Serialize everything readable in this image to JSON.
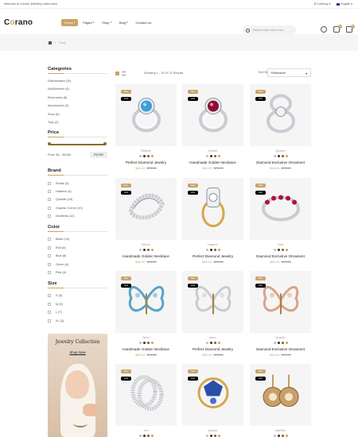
{
  "topbar": {
    "welcome": "Welcome to Corano Jewellery online store",
    "currency": "$ Currency",
    "language": "English"
  },
  "logo": {
    "pre": "C",
    "o": "o",
    "post": "rano"
  },
  "nav": [
    {
      "label": "Home",
      "active": true
    },
    {
      "label": "Pages"
    },
    {
      "label": "Shop"
    },
    {
      "label": "Blog"
    },
    {
      "label": "Contact Us"
    }
  ],
  "search": {
    "placeholder": "Search entire store here"
  },
  "header": {
    "wishlist_count": "0",
    "cart_count": "0"
  },
  "breadcrumb": {
    "current": "Shop"
  },
  "sidebar": {
    "categories_title": "Categories",
    "categories": [
      "Fashionware (10)",
      "Kid&amp;Women (5)",
      "Electronics (8)",
      "Accessories (4)",
      "Shoe (5)",
      "Toys (2)"
    ],
    "price_title": "Price",
    "price_range": "Price:  $1 - $1000",
    "filter_label": "FILTER",
    "brand_title": "Brand",
    "brands": [
      "Studio (3)",
      "Hastech (4)",
      "Quickiin (15)",
      "Graphic Corner (10)",
      "Devitems (12)"
    ],
    "color_title": "Color",
    "colors": [
      "Black (20)",
      "Red (6)",
      "Blue (8)",
      "Green (4)",
      "Pink (4)"
    ],
    "size_title": "Size",
    "sizes": [
      "S (4)",
      "M (5)",
      "L (7)",
      "XL (3)"
    ],
    "promo_title": "Jewelry Collection",
    "promo_button": "Shop Now"
  },
  "toolbar": {
    "showing": "Showing 1 - 16 Of 21 Results",
    "sortby": "Sort By :",
    "sort_value": "Relevance"
  },
  "labels": {
    "new": "New",
    "sale": "10%"
  },
  "products": [
    {
      "brand": "Platinum",
      "name": "Perfect Diamond Jewelry",
      "price": "$60.00",
      "old": "$70.00",
      "art": "ring-blue"
    },
    {
      "brand": "Quickiin",
      "name": "Handmade Golden Necklace",
      "price": "$60.00",
      "old": "$70.00",
      "art": "ring-red"
    },
    {
      "brand": "Quickiin",
      "name": "Diamond Exclusive Ornament",
      "price": "$60.00",
      "old": "$70.00",
      "art": "ring-double"
    },
    {
      "brand": "BDono",
      "name": "Handmade Golden Necklace",
      "price": "$60.00",
      "old": "$70.00",
      "art": "ring-leaf"
    },
    {
      "brand": "Hastech",
      "name": "Perfect Diamond Jewelry",
      "price": "$60.00",
      "old": "$70.00",
      "art": "ring-gold"
    },
    {
      "brand": "Gold",
      "name": "Diamond Exclusive Ornament",
      "price": "$60.00",
      "old": "$70.00",
      "art": "ring-ruby"
    },
    {
      "brand": "Silver",
      "name": "Handmade Golden Necklace",
      "price": "$60.00",
      "old": "$70.00",
      "art": "butterfly-blue"
    },
    {
      "brand": "Mavs",
      "name": "Perfect Diamond Jewelry",
      "price": "$60.00",
      "old": "$70.00",
      "art": "butterfly-white"
    },
    {
      "brand": "Quickiin",
      "name": "Diamond Exclusive Ornament",
      "price": "$60.00",
      "old": "$70.00",
      "art": "butterfly-rose"
    },
    {
      "brand": "Jem",
      "name": "",
      "price": "",
      "old": "",
      "art": "rings-eternity"
    },
    {
      "brand": "Quickiin",
      "name": "",
      "price": "",
      "old": "",
      "art": "brooch-blue"
    },
    {
      "brand": "HasTech",
      "name": "",
      "price": "",
      "old": "",
      "art": "earrings"
    }
  ],
  "swatches": [
    "#bfbfbf",
    "#333333",
    "#8b5a2b",
    "#c9a467"
  ],
  "accent": "#c9a467"
}
